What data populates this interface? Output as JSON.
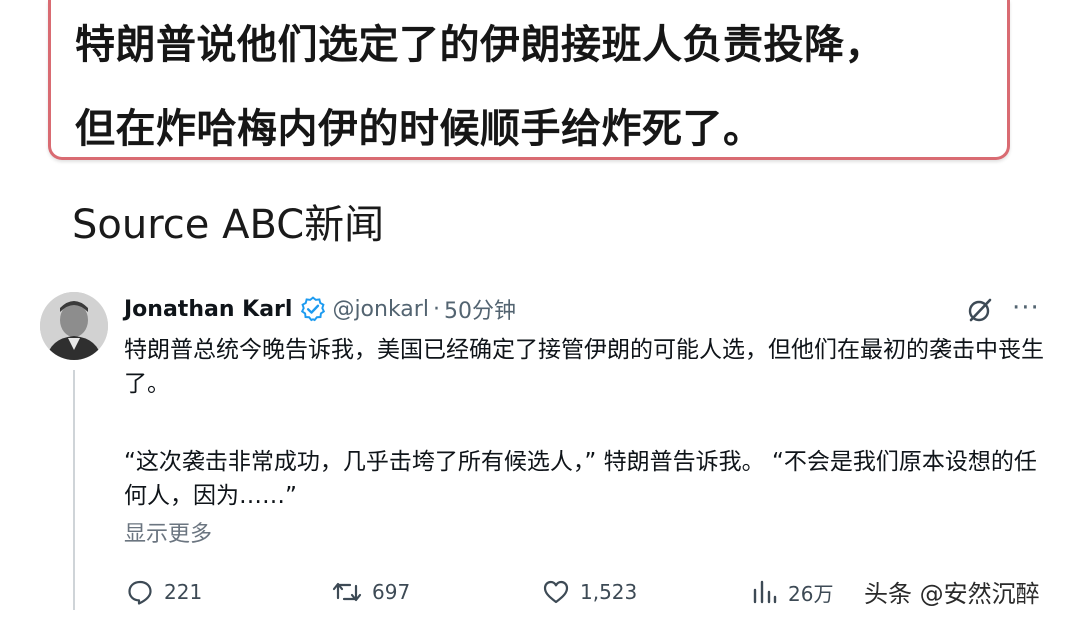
{
  "caption": {
    "line1": "特朗普说他们选定了的伊朗接班人负责投降，",
    "line2": "但在炸哈梅内伊的时候顺手给炸死了。"
  },
  "source": "Source ABC新闻",
  "tweet": {
    "author": "Jonathan Karl",
    "handle": "@jonkarl",
    "separator": "·",
    "time": "50分钟",
    "paragraph1": "特朗普总统今晚告诉我，美国已经确定了接管伊朗的可能人选，但他们在最初的袭击中丧生了。",
    "paragraph2": "“这次袭击非常成功，几乎击垮了所有候选人，” 特朗普告诉我。 “不会是我们原本设想的任何人，因为……”",
    "show_more": "显示更多",
    "more_menu": "···",
    "actions": {
      "replies": "221",
      "reposts": "697",
      "likes": "1,523",
      "views": "26万"
    }
  },
  "watermark": "头条 @安然沉醉",
  "colors": {
    "caption_border": "#d96b72",
    "verified": "#1d9bf0",
    "secondary_text": "#536471"
  }
}
